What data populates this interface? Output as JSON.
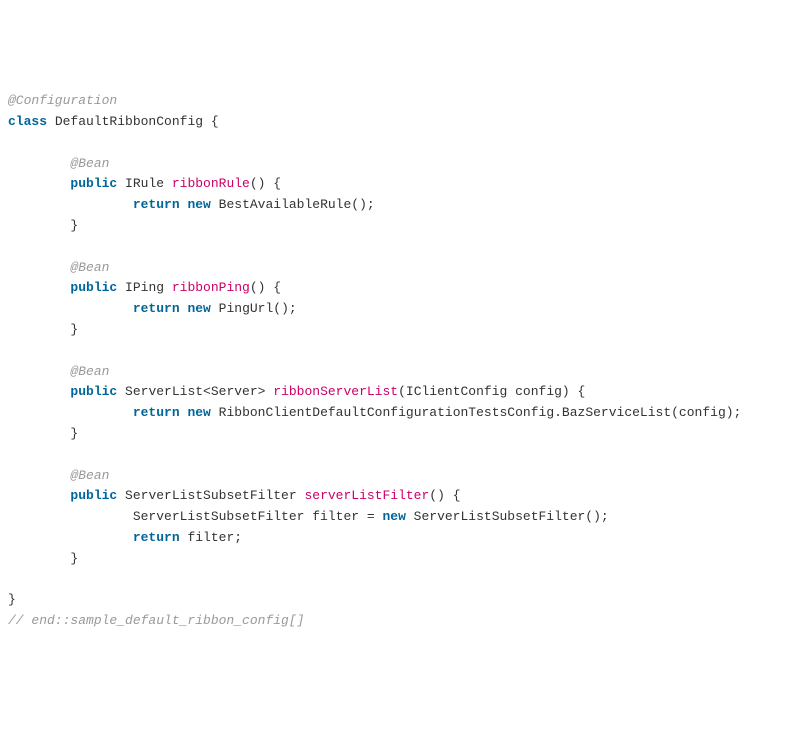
{
  "tokens": [
    {
      "class": "annotation",
      "text": "@Configuration"
    },
    {
      "class": "plain",
      "text": "\n"
    },
    {
      "class": "keyword",
      "text": "class"
    },
    {
      "class": "plain",
      "text": " DefaultRibbonConfig {\n\n"
    },
    {
      "class": "plain",
      "text": "        "
    },
    {
      "class": "annotation",
      "text": "@Bean"
    },
    {
      "class": "plain",
      "text": "\n        "
    },
    {
      "class": "keyword",
      "text": "public"
    },
    {
      "class": "plain",
      "text": " IRule "
    },
    {
      "class": "method",
      "text": "ribbonRule"
    },
    {
      "class": "plain",
      "text": "() {\n                "
    },
    {
      "class": "keyword",
      "text": "return"
    },
    {
      "class": "plain",
      "text": " "
    },
    {
      "class": "new-kw",
      "text": "new"
    },
    {
      "class": "plain",
      "text": " BestAvailableRule();\n        }\n\n"
    },
    {
      "class": "plain",
      "text": "        "
    },
    {
      "class": "annotation",
      "text": "@Bean"
    },
    {
      "class": "plain",
      "text": "\n        "
    },
    {
      "class": "keyword",
      "text": "public"
    },
    {
      "class": "plain",
      "text": " IPing "
    },
    {
      "class": "method",
      "text": "ribbonPing"
    },
    {
      "class": "plain",
      "text": "() {\n                "
    },
    {
      "class": "keyword",
      "text": "return"
    },
    {
      "class": "plain",
      "text": " "
    },
    {
      "class": "new-kw",
      "text": "new"
    },
    {
      "class": "plain",
      "text": " PingUrl();\n        }\n\n"
    },
    {
      "class": "plain",
      "text": "        "
    },
    {
      "class": "annotation",
      "text": "@Bean"
    },
    {
      "class": "plain",
      "text": "\n        "
    },
    {
      "class": "keyword",
      "text": "public"
    },
    {
      "class": "plain",
      "text": " ServerList<Server> "
    },
    {
      "class": "method",
      "text": "ribbonServerList"
    },
    {
      "class": "plain",
      "text": "(IClientConfig config) {\n                "
    },
    {
      "class": "keyword",
      "text": "return"
    },
    {
      "class": "plain",
      "text": " "
    },
    {
      "class": "new-kw",
      "text": "new"
    },
    {
      "class": "plain",
      "text": " RibbonClientDefaultConfigurationTestsConfig.BazServiceList(config);\n        }\n\n"
    },
    {
      "class": "plain",
      "text": "        "
    },
    {
      "class": "annotation",
      "text": "@Bean"
    },
    {
      "class": "plain",
      "text": "\n        "
    },
    {
      "class": "keyword",
      "text": "public"
    },
    {
      "class": "plain",
      "text": " ServerListSubsetFilter "
    },
    {
      "class": "method",
      "text": "serverListFilter"
    },
    {
      "class": "plain",
      "text": "() {\n                ServerListSubsetFilter filter = "
    },
    {
      "class": "new-kw",
      "text": "new"
    },
    {
      "class": "plain",
      "text": " ServerListSubsetFilter();\n                "
    },
    {
      "class": "keyword",
      "text": "return"
    },
    {
      "class": "plain",
      "text": " filter;\n        }\n\n}\n"
    },
    {
      "class": "comment",
      "text": "// end::sample_default_ribbon_config[]"
    }
  ]
}
